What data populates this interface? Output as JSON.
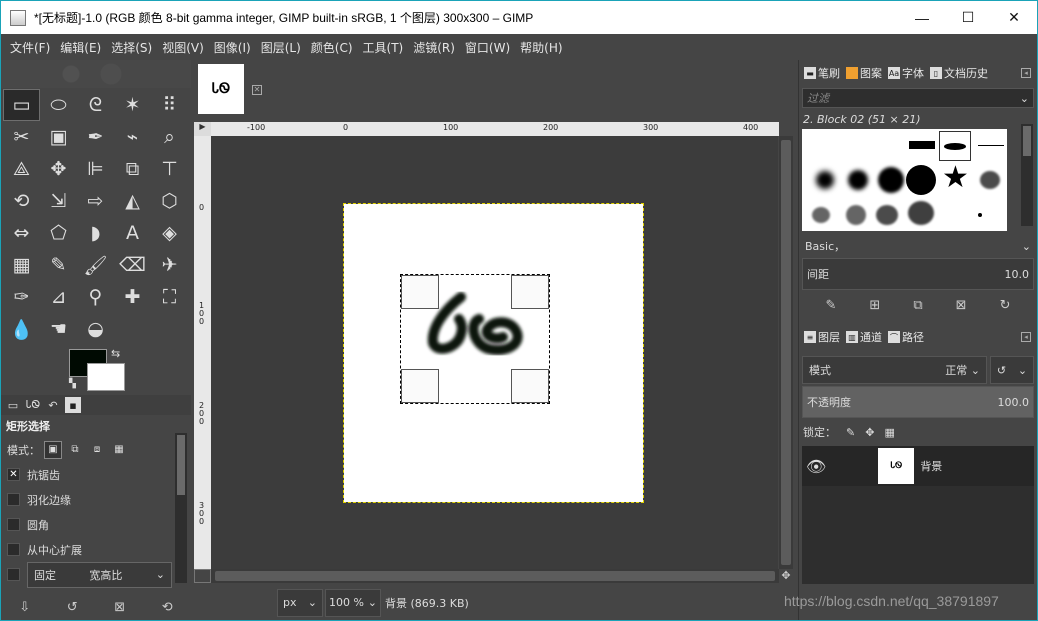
{
  "window": {
    "title": "*[无标题]-1.0 (RGB 颜色 8-bit gamma integer, GIMP built-in sRGB, 1 个图层) 300x300 – GIMP",
    "minimize": "—",
    "maximize": "☐",
    "close": "✕"
  },
  "menubar": [
    "文件(F)",
    "编辑(E)",
    "选择(S)",
    "视图(V)",
    "图像(I)",
    "图层(L)",
    "颜色(C)",
    "工具(T)",
    "滤镜(R)",
    "窗口(W)",
    "帮助(H)"
  ],
  "toolbox": {
    "tools": [
      {
        "name": "rect-select-icon",
        "glyph": "▭",
        "active": true
      },
      {
        "name": "ellipse-select-icon",
        "glyph": "⬭"
      },
      {
        "name": "free-select-icon",
        "glyph": "ᘓ"
      },
      {
        "name": "fuzzy-select-icon",
        "glyph": "✶"
      },
      {
        "name": "select-by-color-icon",
        "glyph": "⠿"
      },
      {
        "name": "scissors-icon",
        "glyph": "✂"
      },
      {
        "name": "foreground-select-icon",
        "glyph": "▣"
      },
      {
        "name": "paths-icon",
        "glyph": "✒"
      },
      {
        "name": "color-picker-icon",
        "glyph": "⌁"
      },
      {
        "name": "zoom-icon",
        "glyph": "⌕"
      },
      {
        "name": "measure-icon",
        "glyph": "⟁"
      },
      {
        "name": "move-icon",
        "glyph": "✥"
      },
      {
        "name": "align-icon",
        "glyph": "⊫"
      },
      {
        "name": "crop-icon",
        "glyph": "⧉"
      },
      {
        "name": "unified-transform-icon",
        "glyph": "⊤"
      },
      {
        "name": "rotate-icon",
        "glyph": "⟲"
      },
      {
        "name": "scale-icon",
        "glyph": "⇲"
      },
      {
        "name": "shear-icon",
        "glyph": "⇨"
      },
      {
        "name": "perspective-icon",
        "glyph": "◭"
      },
      {
        "name": "3d-transform-icon",
        "glyph": "⬡"
      },
      {
        "name": "flip-icon",
        "glyph": "⇔"
      },
      {
        "name": "cage-icon",
        "glyph": "⬠"
      },
      {
        "name": "warp-icon",
        "glyph": "◗"
      },
      {
        "name": "text-icon",
        "glyph": "A"
      },
      {
        "name": "bucket-fill-icon",
        "glyph": "◈"
      },
      {
        "name": "gradient-icon",
        "glyph": "▦"
      },
      {
        "name": "pencil-icon",
        "glyph": "✎"
      },
      {
        "name": "paintbrush-icon",
        "glyph": "🖌"
      },
      {
        "name": "eraser-icon",
        "glyph": "⌫"
      },
      {
        "name": "airbrush-icon",
        "glyph": "✈"
      },
      {
        "name": "ink-icon",
        "glyph": "✑"
      },
      {
        "name": "mypaint-icon",
        "glyph": "⊿"
      },
      {
        "name": "clone-icon",
        "glyph": "⚲"
      },
      {
        "name": "heal-icon",
        "glyph": "✚"
      },
      {
        "name": "perspective-clone-icon",
        "glyph": "⛶"
      },
      {
        "name": "blur-icon",
        "glyph": "💧"
      },
      {
        "name": "smudge-icon",
        "glyph": "☚"
      },
      {
        "name": "dodge-burn-icon",
        "glyph": "◒"
      }
    ],
    "fg_color": "#000a02",
    "bg_color": "#ffffff"
  },
  "tool_options": {
    "title": "矩形选择",
    "mode_label": "模式：",
    "antialias": "抗锯齿",
    "feather": "羽化边缘",
    "rounded": "圆角",
    "expand_center": "从中心扩展",
    "fixed": "固定",
    "fixed_value": "宽高比"
  },
  "image_tab": {
    "thumb_text": "ᏓᏫ"
  },
  "rulers": {
    "top": [
      "-100",
      "0",
      "100",
      "200",
      "300",
      "400"
    ],
    "left": [
      "0",
      "1\n0\n0",
      "2\n0\n0",
      "3\n0\n0"
    ]
  },
  "status": {
    "unit": "px",
    "zoom": "100 %",
    "info": "背景 (869.3 KB)"
  },
  "right_dock": {
    "tabs": [
      "笔刷",
      "图案",
      "字体",
      "文档历史"
    ],
    "filter_placeholder": "过滤",
    "brush_name": "2. Block 02 (51 × 21)",
    "basic": "Basic，",
    "spacing_label": "间距",
    "spacing_value": "10.0",
    "layer_tabs": [
      "图层",
      "通道",
      "路径"
    ],
    "mode_label": "模式",
    "mode_value": "正常",
    "opacity_label": "不透明度",
    "opacity_value": "100.0",
    "lock_label": "锁定：",
    "layer_name": "背景"
  },
  "watermark": "https://blog.csdn.net/qq_38791897"
}
